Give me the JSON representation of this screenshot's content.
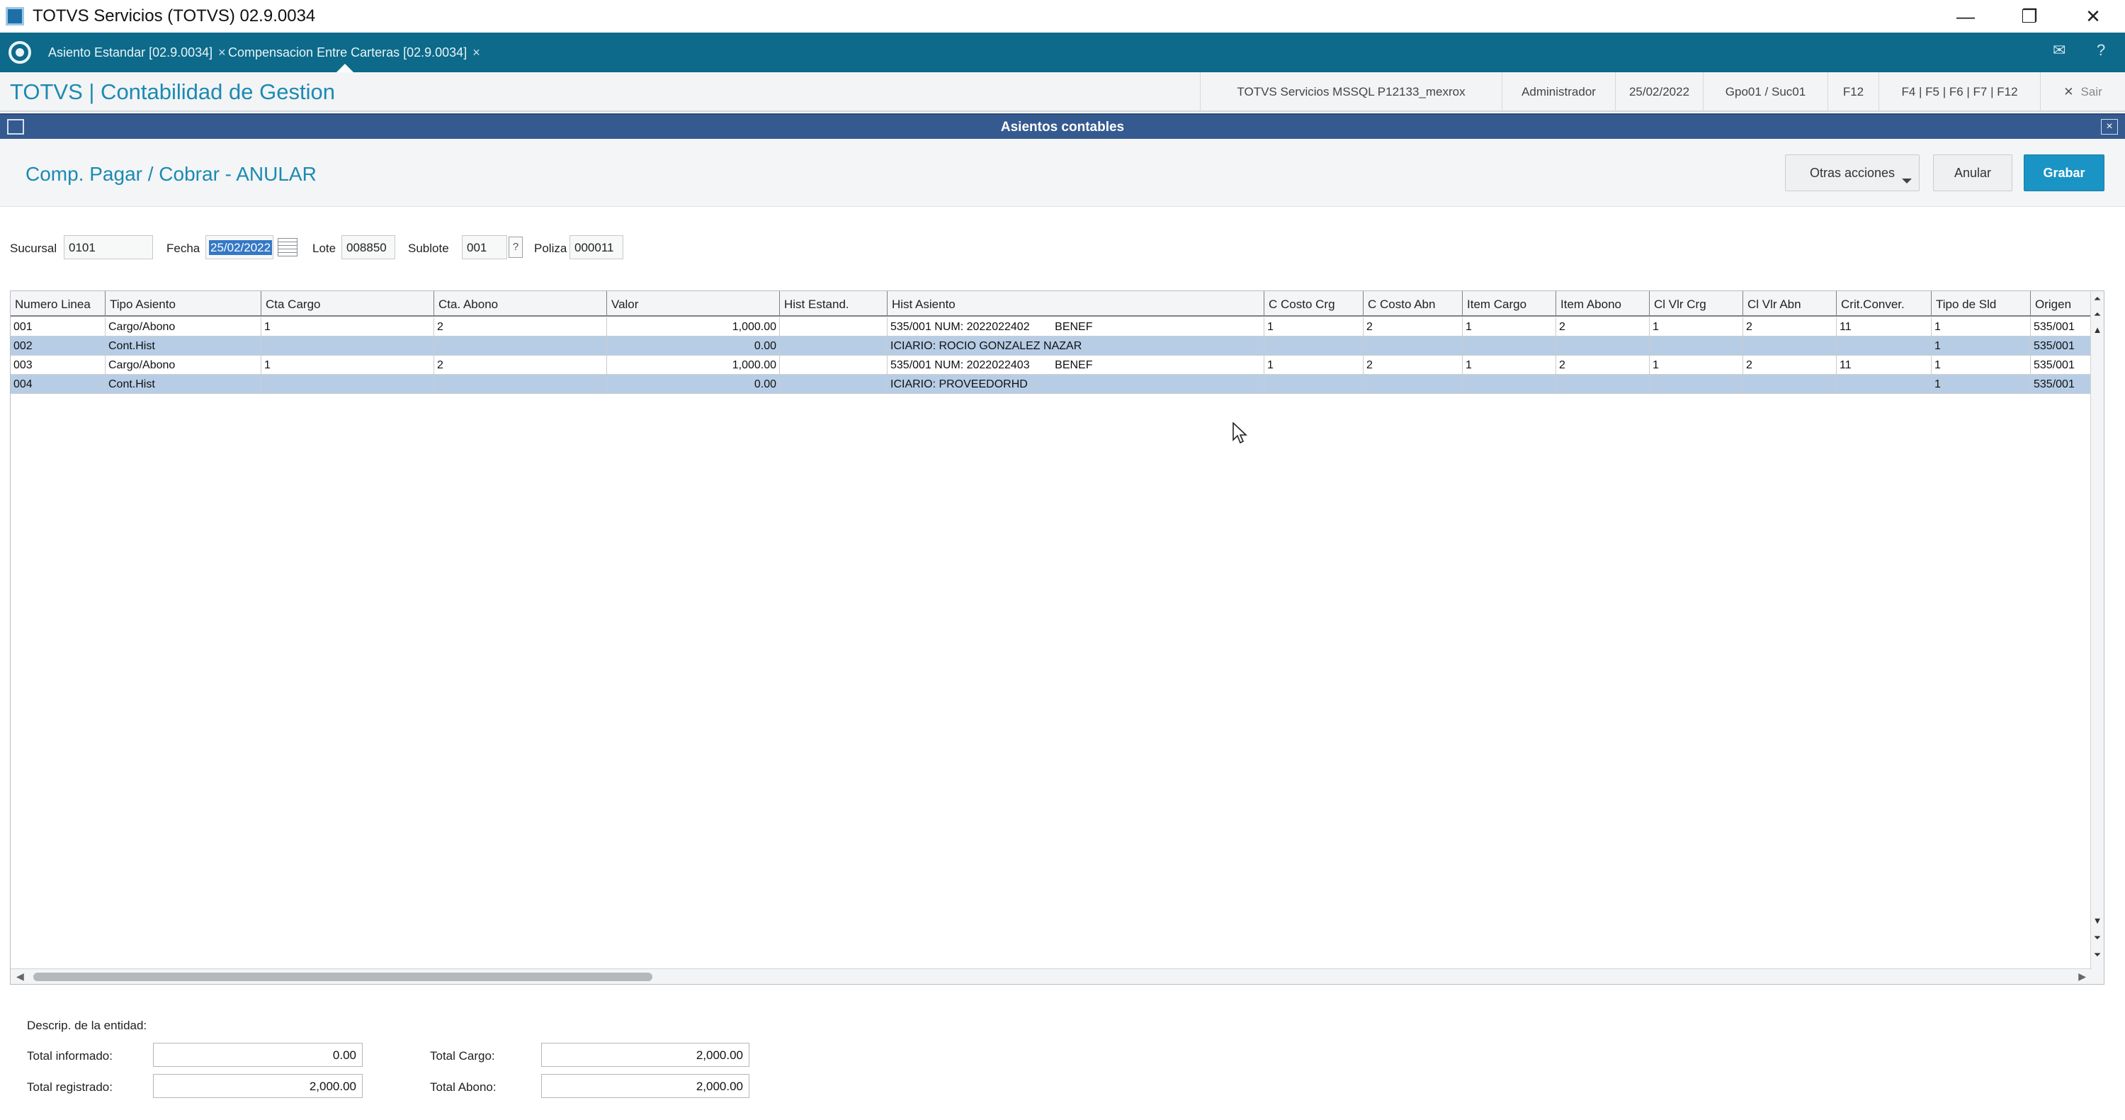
{
  "window": {
    "title": "TOTVS Servicios (TOTVS) 02.9.0034",
    "minimize_glyph": "—",
    "restore_glyph": "❐",
    "close_glyph": "✕"
  },
  "tabs": [
    {
      "label": "Asiento Estandar [02.9.0034]",
      "close": "×"
    },
    {
      "label": "Compensacion Entre Carteras [02.9.0034]",
      "close": "×"
    }
  ],
  "tabbar_icons": {
    "mail": "✉",
    "help": "?"
  },
  "header": {
    "product": "TOTVS | Contabilidad de Gestion",
    "server": "TOTVS Servicios MSSQL P12133_mexrox",
    "user": "Administrador",
    "date": "25/02/2022",
    "branch": "Gpo01 / Suc01",
    "f12": "F12",
    "shortcuts": "F4 | F5 | F6 | F7 | F12",
    "exit_label": "Sair",
    "exit_glyph": "✕"
  },
  "frame": {
    "title": "Asientos contables",
    "close": "×"
  },
  "page": {
    "title": "Comp. Pagar / Cobrar - ANULAR",
    "btn_more": "Otras acciones",
    "btn_cancel": "Anular",
    "btn_save": "Grabar"
  },
  "fields": {
    "sucursal_label": "Sucursal",
    "sucursal": "0101",
    "fecha_label": "Fecha",
    "fecha": "25/02/2022",
    "lote_label": "Lote",
    "lote": "008850",
    "sublote_label": "Sublote",
    "sublote": "001",
    "sublote_help": "?",
    "poliza_label": "Poliza",
    "poliza": "000011"
  },
  "grid": {
    "columns": [
      "Numero Linea",
      "Tipo Asiento",
      "Cta Cargo",
      "Cta. Abono",
      "Valor",
      "Hist Estand.",
      "Hist Asiento",
      "C Costo Crg",
      "C Costo Abn",
      "Item Cargo",
      "Item Abono",
      "Cl Vlr Crg",
      "Cl Vlr Abn",
      "Crit.Conver.",
      "Tipo de Sld",
      "Origen"
    ],
    "rows": [
      [
        "001",
        "Cargo/Abono",
        "1",
        "2",
        "1,000.00",
        "",
        "535/001 NUM: 2022022402        BENEF",
        "1",
        "2",
        "1",
        "2",
        "1",
        "2",
        "11",
        "1",
        "535/001"
      ],
      [
        "002",
        "Cont.Hist",
        "",
        "",
        "0.00",
        "",
        "ICIARIO: ROCIO GONZALEZ NAZAR",
        "",
        "",
        "",
        "",
        "",
        "",
        "",
        "1",
        "535/001"
      ],
      [
        "003",
        "Cargo/Abono",
        "1",
        "2",
        "1,000.00",
        "",
        "535/001 NUM: 2022022403        BENEF",
        "1",
        "2",
        "1",
        "2",
        "1",
        "2",
        "11",
        "1",
        "535/001"
      ],
      [
        "004",
        "Cont.Hist",
        "",
        "",
        "0.00",
        "",
        "ICIARIO: PROVEEDORHD",
        "",
        "",
        "",
        "",
        "",
        "",
        "",
        "1",
        "535/001"
      ]
    ],
    "scroll_top": "⏶",
    "scroll_up": "▲",
    "scroll_down": "▼",
    "scroll_bottom": "⏷",
    "scroll_left": "◀",
    "scroll_right": "▶"
  },
  "footer": {
    "entity_label": "Descrip. de la entidad:",
    "total_informado_label": "Total informado:",
    "total_informado": "0.00",
    "total_registrado_label": "Total registrado:",
    "total_registrado": "2,000.00",
    "total_cargo_label": "Total Cargo:",
    "total_cargo": "2,000.00",
    "total_abono_label": "Total Abono:",
    "total_abono": "2,000.00"
  }
}
